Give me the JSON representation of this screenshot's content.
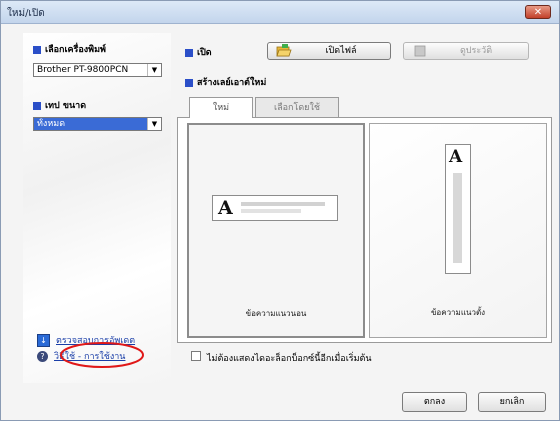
{
  "window": {
    "title": "ใหม่/เปิด",
    "close_glyph": "✕"
  },
  "left": {
    "printer_label": "เลือกเครื่องพิมพ์",
    "printer_value": "Brother PT-9800PCN",
    "tape_label": "เทป ขนาด",
    "tape_value": "ทั้งหมด",
    "update_link": "ตรวจสอบการอัพเดต",
    "help_link": "วิธีใช้ - การใช้งาน"
  },
  "right": {
    "open_label": "เปิด",
    "open_file_button": "เปิดไฟล์",
    "history_button": "ดูประวัติ",
    "new_layout_label": "สร้างเลย์เอาต์ใหม่",
    "tabs": [
      {
        "label": "ใหม่"
      },
      {
        "label": "เลือกโดยใช้"
      }
    ],
    "options": [
      {
        "label": "ข้อความแนวนอน",
        "glyph": "A"
      },
      {
        "label": "ข้อความแนวตั้ง",
        "glyph": "A"
      }
    ],
    "dont_show_checkbox_label": "ไม่ต้องแสดงไดอะล็อกบ็อกซ์นี้อีกเมื่อเริ่มต้น",
    "dont_show_checked": false
  },
  "footer": {
    "ok_button": "ตกลง",
    "cancel_button": "ยกเลิก"
  },
  "colors": {
    "accent": "#2b4fc8",
    "selection": "#3a6bd6",
    "link": "#1a3ea8",
    "highlight_ring": "#e01818"
  },
  "icons": [
    "close-icon",
    "folder-open-icon",
    "history-icon",
    "dropdown-arrow-icon",
    "update-icon",
    "help-icon"
  ]
}
